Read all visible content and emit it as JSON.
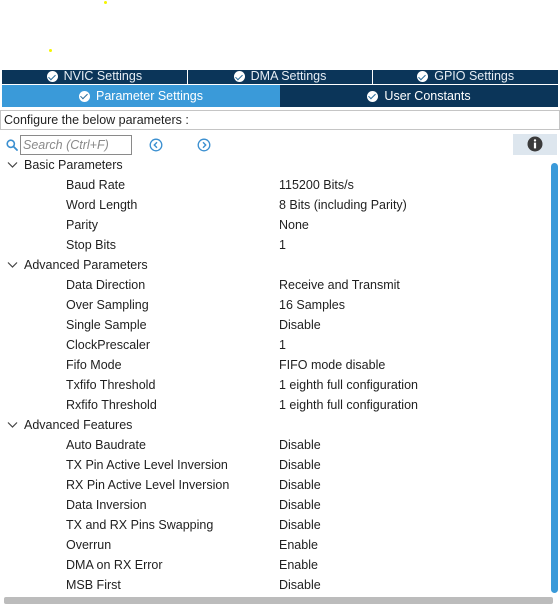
{
  "tabs": {
    "top": [
      {
        "label": "NVIC Settings"
      },
      {
        "label": "DMA Settings"
      },
      {
        "label": "GPIO Settings"
      }
    ],
    "bottom": [
      {
        "label": "Parameter Settings",
        "active": true
      },
      {
        "label": "User Constants",
        "active": false
      }
    ]
  },
  "config_text": "Configure the below parameters :",
  "search": {
    "placeholder": "Search (Ctrl+F)"
  },
  "icons": {
    "search": "search-icon",
    "prev": "arrow-left-circle-icon",
    "next": "arrow-right-circle-icon",
    "info": "info-icon",
    "check": "check-circle-icon",
    "chevron": "chevron-down-icon"
  },
  "colors": {
    "tab_dark": "#0b3559",
    "tab_active": "#3a9ad9",
    "scroll_thumb": "#3a9ad9"
  },
  "groups": [
    {
      "label": "Basic Parameters",
      "params": [
        {
          "name": "Baud Rate",
          "value": "115200 Bits/s"
        },
        {
          "name": "Word Length",
          "value": "8 Bits (including Parity)"
        },
        {
          "name": "Parity",
          "value": "None"
        },
        {
          "name": "Stop Bits",
          "value": "1"
        }
      ]
    },
    {
      "label": "Advanced Parameters",
      "params": [
        {
          "name": "Data Direction",
          "value": "Receive and Transmit"
        },
        {
          "name": "Over Sampling",
          "value": "16 Samples"
        },
        {
          "name": "Single Sample",
          "value": "Disable"
        },
        {
          "name": "ClockPrescaler",
          "value": "1"
        },
        {
          "name": "Fifo Mode",
          "value": "FIFO mode disable"
        },
        {
          "name": "Txfifo Threshold",
          "value": "1 eighth full configuration"
        },
        {
          "name": "Rxfifo Threshold",
          "value": "1 eighth full configuration"
        }
      ]
    },
    {
      "label": "Advanced Features",
      "params": [
        {
          "name": "Auto Baudrate",
          "value": "Disable"
        },
        {
          "name": "TX Pin Active Level Inversion",
          "value": "Disable"
        },
        {
          "name": "RX Pin Active Level Inversion",
          "value": "Disable"
        },
        {
          "name": "Data Inversion",
          "value": "Disable"
        },
        {
          "name": "TX and RX Pins Swapping",
          "value": "Disable"
        },
        {
          "name": "Overrun",
          "value": "Enable"
        },
        {
          "name": "DMA on RX Error",
          "value": "Enable"
        },
        {
          "name": "MSB First",
          "value": "Disable"
        }
      ]
    }
  ]
}
